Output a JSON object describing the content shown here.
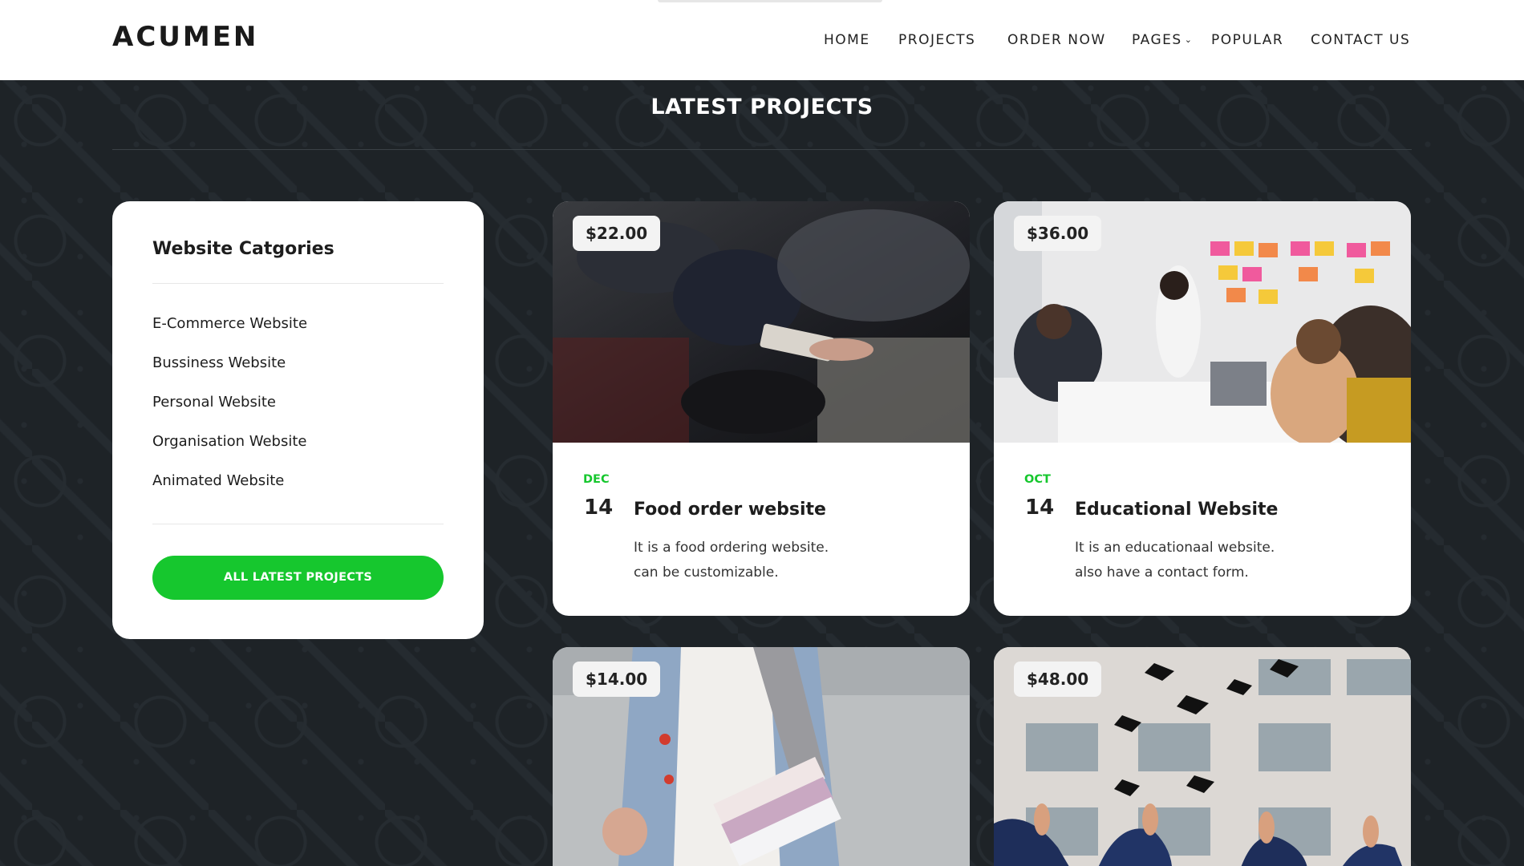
{
  "header": {
    "logo": "ACUMEN",
    "nav": [
      {
        "label": "HOME"
      },
      {
        "label": "PROJECTS"
      },
      {
        "label": "ORDER NOW"
      },
      {
        "label": "PAGES"
      },
      {
        "label": "POPULAR"
      },
      {
        "label": "CONTACT US"
      }
    ]
  },
  "section": {
    "title": "LATEST PROJECTS"
  },
  "sidebar": {
    "title": "Website Catgories",
    "categories": [
      "E-Commerce Website",
      "Bussiness Website",
      "Personal Website",
      "Organisation Website",
      "Animated Website"
    ],
    "button_label": "ALL LATEST PROJECTS"
  },
  "cards": [
    {
      "price": "$22.00",
      "month": "DEC",
      "day": "14",
      "title": "Food order website",
      "desc_line1": "It is a food ordering website.",
      "desc_line2": "can be customizable."
    },
    {
      "price": "$36.00",
      "month": "OCT",
      "day": "14",
      "title": "Educational Website",
      "desc_line1": "It is an educationaal website.",
      "desc_line2": "also have a contact form."
    },
    {
      "price": "$14.00"
    },
    {
      "price": "$48.00"
    }
  ],
  "colors": {
    "accent": "#16c72e",
    "background": "#1e2327",
    "header_bg": "#ffffff"
  }
}
